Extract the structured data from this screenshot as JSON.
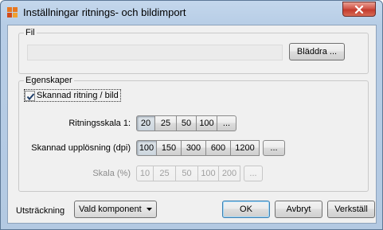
{
  "window": {
    "title": "Inställningar ritnings- och bildimport"
  },
  "file_group": {
    "legend": "Fil",
    "path_value": "",
    "browse_label": "Bläddra ..."
  },
  "props_group": {
    "legend": "Egenskaper",
    "scanned_checkbox_label": "Skannad ritning / bild",
    "scanned_checked": true,
    "drawing_scale": {
      "label": "Ritningsskala 1:",
      "options": [
        "20",
        "25",
        "50",
        "100"
      ],
      "selected": "20",
      "more_label": "..."
    },
    "scan_resolution": {
      "label": "Skannad upplösning (dpi)",
      "options": [
        "100",
        "150",
        "300",
        "600",
        "1200"
      ],
      "selected": "100",
      "more_label": "..."
    },
    "scale_percent": {
      "label": "Skala (%)",
      "options": [
        "10",
        "25",
        "50",
        "100",
        "200"
      ],
      "more_label": "...",
      "enabled": false
    }
  },
  "footer": {
    "extent_label": "Utsträckning",
    "extent_value": "Vald komponent",
    "ok_label": "OK",
    "cancel_label": "Avbryt",
    "apply_label": "Verkställ"
  },
  "colors": {
    "close_button": "#c33b2d",
    "default_button_border": "#3c7fb1",
    "dialog_background": "#f0f0f0"
  }
}
